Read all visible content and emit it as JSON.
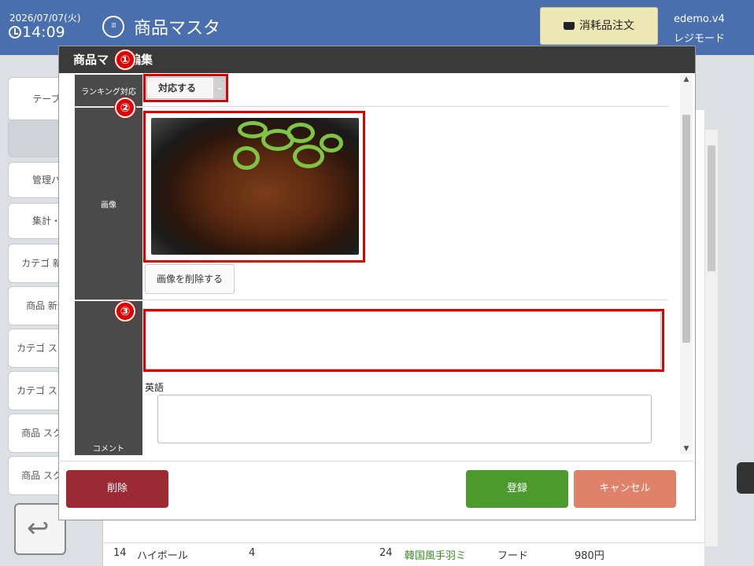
{
  "header": {
    "date": "2026/07/07(火)",
    "time": "14:09",
    "title": "商品マスタ",
    "order_button": "消耗品注文",
    "user": "edemo.v4",
    "mode": "レジモード"
  },
  "sidebar": {
    "items": [
      {
        "label": "テーブル"
      },
      {
        "label": ""
      },
      {
        "label": "管理パネ"
      },
      {
        "label": "集計・分"
      },
      {
        "label": "カテゴ 新規登"
      },
      {
        "label": "商品 新規登"
      },
      {
        "label": "カテゴ スクロー"
      },
      {
        "label": "カテゴ スクロー"
      },
      {
        "label": "商品 スクロー"
      },
      {
        "label": "商品 スクロー"
      }
    ]
  },
  "background_table": {
    "rows": [
      {
        "no": "14",
        "name": "ハイボール",
        "qty": "4",
        "no2": "24",
        "name2": "韓国風手羽ミ",
        "cat": "フード",
        "price": "980円"
      }
    ]
  },
  "modal": {
    "title_prefix": "商品マ",
    "title_suffix": "編集",
    "ranking_label": "ランキング対応",
    "ranking_value": "対応する",
    "image_label": "画像",
    "delete_image_button": "画像を削除する",
    "english_label": "英語",
    "comment_label": "コメント",
    "delete_button": "削除",
    "register_button": "登録",
    "cancel_button": "キャンセル"
  },
  "annotations": [
    "①",
    "②",
    "③"
  ],
  "colors": {
    "header_bg": "#4a6fae",
    "delete_btn": "#9b2a35",
    "register_btn": "#4c9a2e",
    "cancel_btn": "#e0826a",
    "annotation": "#e00000"
  }
}
